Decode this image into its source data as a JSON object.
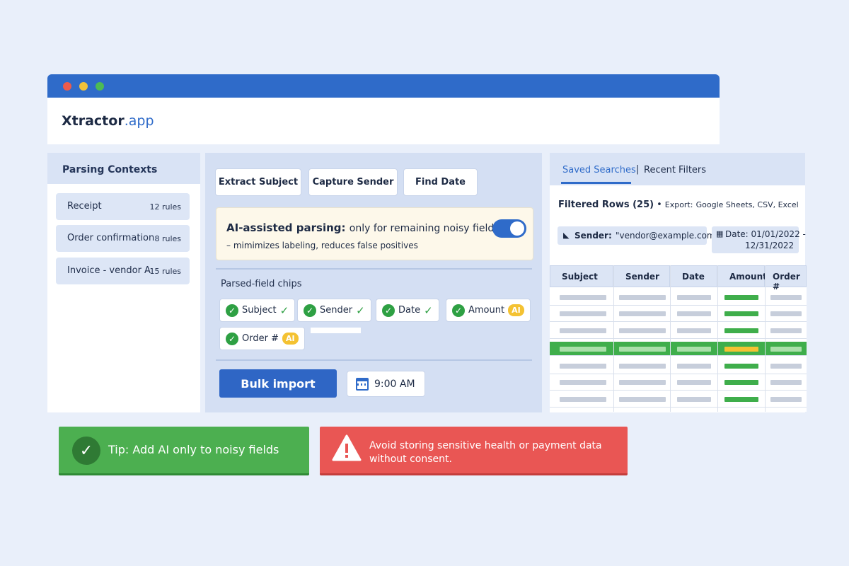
{
  "app": {
    "brand_name": "Xtractor",
    "brand_tld": ".app"
  },
  "sidebar": {
    "title": "Parsing Contexts",
    "items": [
      {
        "label": "Receipt",
        "count": "12 rules"
      },
      {
        "label": "Order confirmation",
        "count": "8 rules"
      },
      {
        "label": "Invoice - vendor A",
        "count": "15 rules"
      }
    ]
  },
  "toolbar": {
    "extract_subject": "Extract Subject",
    "capture_sender": "Capture Sender",
    "find_date": "Find Date"
  },
  "ai_panel": {
    "title": "AI-assisted parsing:",
    "title_rest": "only for remaining noisy fields",
    "subtitle": "– mimimizes labeling, reduces false positives",
    "enabled": true
  },
  "chips": {
    "label": "Parsed-field chips",
    "items": [
      {
        "label": "Subject",
        "badge": ""
      },
      {
        "label": "Sender",
        "badge": ""
      },
      {
        "label": "Date",
        "badge": ""
      },
      {
        "label": "Amount",
        "badge": "AI"
      },
      {
        "label": "Order #",
        "badge": "AI"
      }
    ]
  },
  "actions": {
    "bulk_import": "Bulk import",
    "time": "9:00 AM"
  },
  "right_panel": {
    "tabs": {
      "saved": "Saved Searches",
      "separator": "|",
      "recent": "Recent Filters"
    },
    "rows_title": "Filtered Rows (25)",
    "separator_dot": "•",
    "export_label": "Export:",
    "export_options": "Google Sheets, CSV, Excel",
    "filter_sender": {
      "label": "Sender:",
      "value": "\"vendor@example.com\""
    },
    "filter_date": {
      "label": "Date: 01/01/2022 -",
      "value": "12/31/2022"
    },
    "columns": [
      "Subject",
      "Sender",
      "Date",
      "Amount",
      "Order #"
    ]
  },
  "alerts": {
    "tip": "Tip: Add AI only to noisy fields",
    "warning": "Avoid storing sensitive health or payment data without consent."
  },
  "colors": {
    "accent": "#2f6bc9",
    "success": "#4caf50",
    "danger": "#e95654",
    "ai_badge": "#f4c232"
  }
}
